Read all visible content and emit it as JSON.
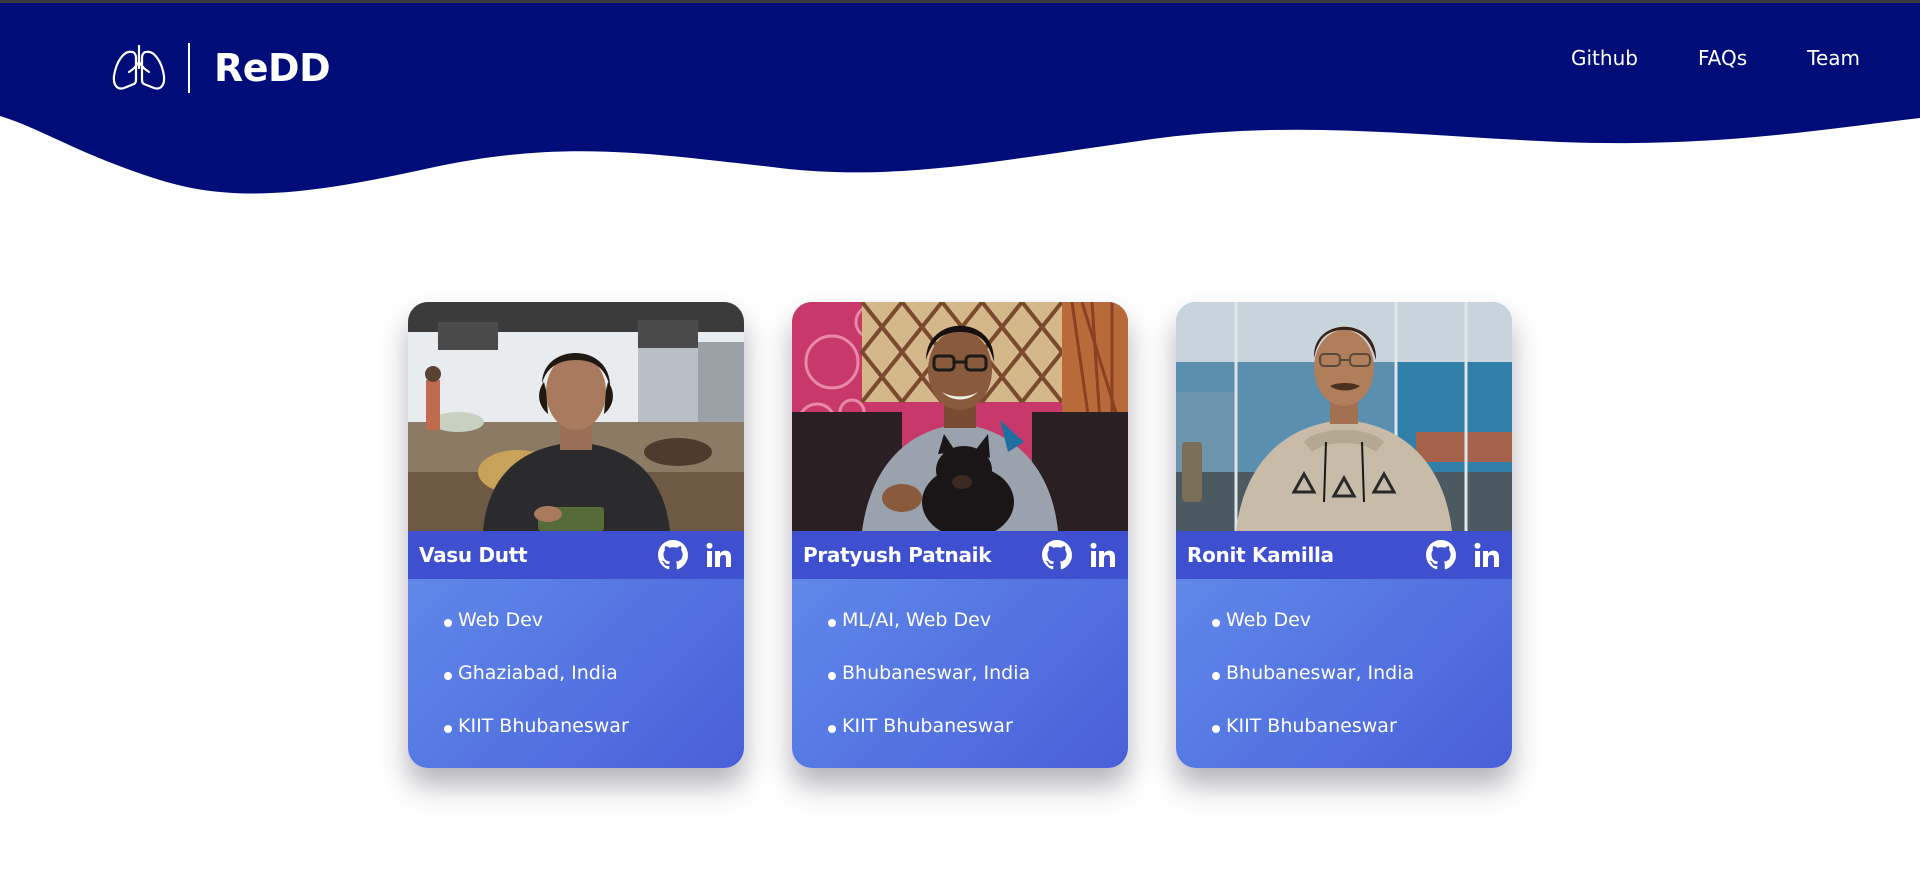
{
  "header": {
    "title": "ReDD",
    "nav": [
      {
        "label": "Github"
      },
      {
        "label": "FAQs"
      },
      {
        "label": "Team"
      }
    ],
    "color": "#000c78"
  },
  "team": [
    {
      "name": "Vasu Dutt",
      "details": [
        "Web Dev",
        "Ghaziabad, India",
        "KIIT Bhubaneswar"
      ]
    },
    {
      "name": "Pratyush Patnaik",
      "details": [
        "ML/AI, Web Dev",
        "Bhubaneswar, India",
        "KIIT Bhubaneswar"
      ]
    },
    {
      "name": "Ronit Kamilla",
      "details": [
        "Web Dev",
        "Bhubaneswar, India",
        "KIIT Bhubaneswar"
      ]
    }
  ],
  "icons": {
    "logo": "lungs-icon",
    "github": "github-icon",
    "linkedin": "linkedin-icon"
  },
  "colors": {
    "accent": "#3e4fd0",
    "card_gradient_start": "#6f97ef",
    "card_gradient_end": "#4a5fd8"
  }
}
